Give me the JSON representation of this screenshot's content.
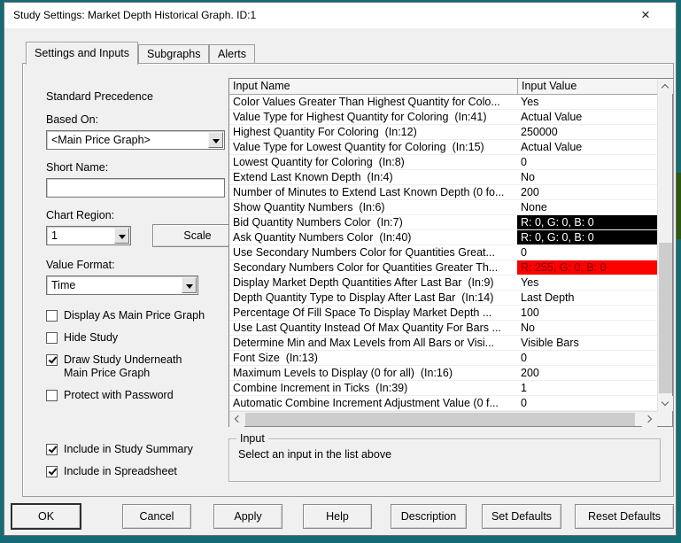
{
  "window": {
    "title": "Study Settings: Market Depth Historical Graph. ID:1",
    "close_glyph": "×"
  },
  "tabs": [
    {
      "label": "Settings and Inputs",
      "active": true
    },
    {
      "label": "Subgraphs",
      "active": false
    },
    {
      "label": "Alerts",
      "active": false
    }
  ],
  "left_panel": {
    "precedence_label": "Standard Precedence",
    "based_on_label": "Based On:",
    "based_on_value": "<Main Price Graph>",
    "short_name_label": "Short Name:",
    "short_name_value": "",
    "chart_region_label": "Chart Region:",
    "chart_region_value": "1",
    "scale_button_label": "Scale",
    "value_format_label": "Value Format:",
    "value_format_value": "Time",
    "checkboxes": [
      {
        "label": "Display As Main Price Graph",
        "checked": false
      },
      {
        "label": "Hide Study",
        "checked": false
      },
      {
        "label": "Draw Study Underneath\nMain Price Graph",
        "checked": true
      },
      {
        "label": "Protect with Password",
        "checked": false
      }
    ],
    "summary_checkboxes": [
      {
        "label": "Include in Study Summary",
        "checked": true
      },
      {
        "label": "Include in Spreadsheet",
        "checked": true
      }
    ]
  },
  "inputs_table": {
    "columns": {
      "name": "Input Name",
      "value": "Input Value"
    },
    "rows": [
      {
        "name": "Color Values Greater Than Highest Quantity for Colo...",
        "value": "Yes"
      },
      {
        "name": "Value Type for Highest Quantity for Coloring  (In:41)",
        "value": "Actual Value"
      },
      {
        "name": "Highest Quantity For Coloring  (In:12)",
        "value": "250000"
      },
      {
        "name": "Value Type for Lowest Quantity for Coloring  (In:15)",
        "value": "Actual Value"
      },
      {
        "name": "Lowest Quantity for Coloring  (In:8)",
        "value": "0"
      },
      {
        "name": "Extend Last Known Depth  (In:4)",
        "value": "No"
      },
      {
        "name": "Number of Minutes to Extend Last Known Depth (0 fo...",
        "value": "200"
      },
      {
        "name": "Show Quantity Numbers  (In:6)",
        "value": "None"
      },
      {
        "name": "Bid Quantity Numbers Color  (In:7)",
        "value": "R: 0, G: 0, B: 0",
        "value_bg": "#000000",
        "value_fg": "#ffffff"
      },
      {
        "name": "Ask Quantity Numbers Color  (In:40)",
        "value": "R: 0, G: 0, B: 0",
        "value_bg": "#000000",
        "value_fg": "#ffffff"
      },
      {
        "name": "Use Secondary Numbers Color for Quantities Great...",
        "value": "0"
      },
      {
        "name": "Secondary Numbers Color for Quantities Greater Th...",
        "value": "R: 255, G: 0, B: 0",
        "value_bg": "#fb0100",
        "value_fg": "#7e0000"
      },
      {
        "name": "Display Market Depth Quantities After Last Bar  (In:9)",
        "value": "Yes"
      },
      {
        "name": "Depth Quantity Type to Display After Last Bar  (In:14)",
        "value": "Last Depth"
      },
      {
        "name": "Percentage Of Fill Space To Display Market Depth ...",
        "value": "100"
      },
      {
        "name": "Use Last Quantity Instead Of Max Quantity For Bars ...",
        "value": "No"
      },
      {
        "name": "Determine Min and Max Levels from All Bars or Visi...",
        "value": "Visible Bars"
      },
      {
        "name": "Font Size  (In:13)",
        "value": "0"
      },
      {
        "name": "Maximum Levels to Display (0 for all)  (In:16)",
        "value": "200"
      },
      {
        "name": "Combine Increment in Ticks  (In:39)",
        "value": "1"
      },
      {
        "name": "Automatic Combine Increment Adjustment Value (0 f...",
        "value": "0"
      }
    ]
  },
  "input_group": {
    "label": "Input",
    "message": "Select an input in the list above"
  },
  "buttons": [
    {
      "label": "OK",
      "default": true
    },
    {
      "label": "Cancel"
    },
    {
      "label": "Apply"
    },
    {
      "label": "Help"
    },
    {
      "label": "Description"
    },
    {
      "label": "Set Defaults"
    },
    {
      "label": "Reset Defaults"
    }
  ],
  "colors": {
    "backdrop_teal": "#156b75",
    "backdrop_green": "#2b5a0e",
    "dialog_bg": "#f0f0f0",
    "titlebar_bg": "#ffffff",
    "swatch_black": "#000000",
    "swatch_red": "#fb0100"
  }
}
